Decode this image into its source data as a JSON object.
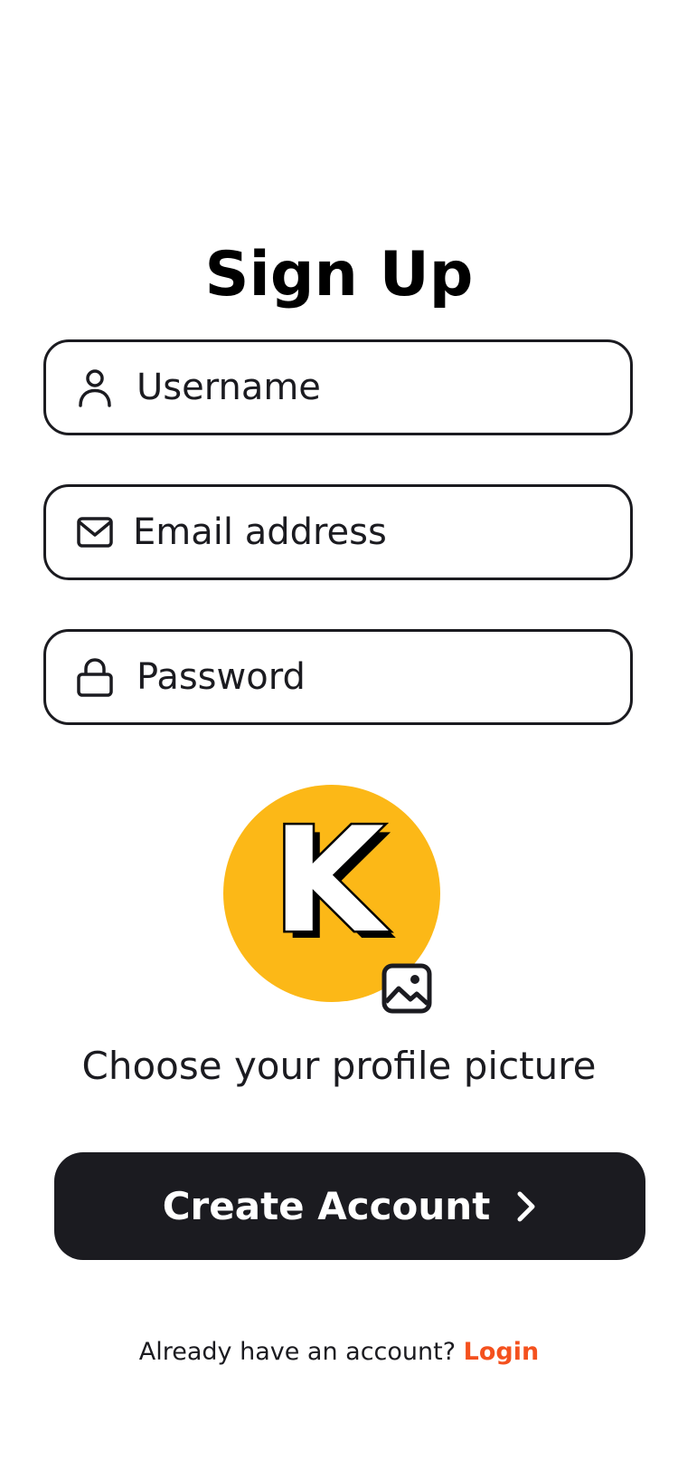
{
  "page": {
    "title": "Sign Up"
  },
  "form": {
    "username": {
      "placeholder": "Username",
      "value": "",
      "icon": "user-icon"
    },
    "email": {
      "placeholder": "Email address",
      "value": "",
      "icon": "envelope-icon"
    },
    "password": {
      "placeholder": "Password",
      "value": "",
      "icon": "lock-icon"
    }
  },
  "profile": {
    "avatar_letter": "K",
    "avatar_color": "#fcb817",
    "upload_icon": "image-icon",
    "label": "Choose your profile picture"
  },
  "actions": {
    "create_label": "Create Account",
    "create_icon": "chevron-right-icon",
    "button_color": "#1b1b20"
  },
  "footer": {
    "prompt": "Already have an account?",
    "login_label": "Login",
    "login_color": "#f4511e"
  }
}
